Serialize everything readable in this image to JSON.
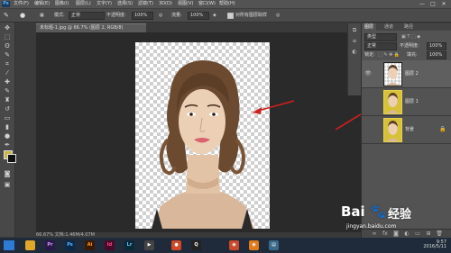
{
  "app": {
    "logo": "Ps"
  },
  "menu": [
    "文件(F)",
    "编辑(E)",
    "图像(I)",
    "图层(L)",
    "文字(Y)",
    "选择(S)",
    "滤镜(T)",
    "3D(D)",
    "视图(V)",
    "窗口(W)",
    "帮助(H)"
  ],
  "window_controls": [
    "—",
    "□",
    "✕"
  ],
  "options": {
    "mode_label": "模式:",
    "mode_value": "正常",
    "opacity_label": "不透明度:",
    "opacity_value": "100%",
    "flow_label": "流量:",
    "flow_value": "100%",
    "sample_label": "对所有图层取样"
  },
  "document": {
    "tab_title": "未标题-1.jpg @ 66.7% (图层 2, RGB/8)",
    "status": "66.67%    文档:1.46M/4.07M"
  },
  "panel": {
    "tabs": [
      "图层",
      "通道",
      "路径"
    ],
    "kind_value": "类型",
    "blend_value": "正常",
    "opacity_label": "不透明度:",
    "opacity_value": "100%",
    "lock_label": "锁定:",
    "fill_label": "填充:",
    "fill_value": "100%",
    "layers": [
      {
        "name": "图层 2",
        "visible": true,
        "selected": true,
        "thumb": "transparent"
      },
      {
        "name": "图层 1",
        "visible": false,
        "selected": false,
        "thumb": "yellow"
      },
      {
        "name": "背景",
        "visible": false,
        "selected": false,
        "thumb": "yellow",
        "locked": true
      }
    ]
  },
  "taskbar": {
    "apps": [
      {
        "name": "explorer",
        "label": "",
        "color": "#e0a826"
      },
      {
        "name": "premiere",
        "label": "Pr",
        "color": "#2a1a4a"
      },
      {
        "name": "photoshop",
        "label": "Ps",
        "color": "#0b2a4a"
      },
      {
        "name": "illustrator",
        "label": "Ai",
        "color": "#3a1a00"
      },
      {
        "name": "indesign",
        "label": "Id",
        "color": "#4a0a2a"
      },
      {
        "name": "lightroom",
        "label": "Lr",
        "color": "#0a2a3a"
      },
      {
        "name": "media",
        "label": "▶",
        "color": "#444"
      },
      {
        "name": "paint",
        "label": "●",
        "color": "#d04a2a"
      },
      {
        "name": "qq",
        "label": "Q",
        "color": "#222"
      },
      {
        "name": "chrome",
        "label": "◉",
        "color": "#c94a2a"
      },
      {
        "name": "firefox",
        "label": "◉",
        "color": "#e07a1a"
      },
      {
        "name": "notes",
        "label": "▤",
        "color": "#3a6a8a"
      }
    ],
    "time": "9:57",
    "date": "2016/5/11"
  },
  "watermark": {
    "brand": "Bai",
    "brand2": "经验",
    "url": "jingyan.baidu.com"
  }
}
